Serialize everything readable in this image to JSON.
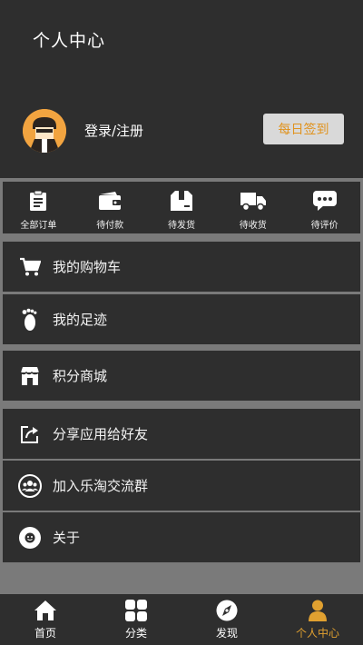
{
  "header": {
    "title": "个人中心",
    "login_text": "登录/注册",
    "checkin_label": "每日签到"
  },
  "orders": [
    {
      "label": "全部订单",
      "icon": "clipboard-icon"
    },
    {
      "label": "待付款",
      "icon": "wallet-icon"
    },
    {
      "label": "待发货",
      "icon": "package-icon"
    },
    {
      "label": "待收货",
      "icon": "truck-icon"
    },
    {
      "label": "待评价",
      "icon": "chat-bubble-icon"
    }
  ],
  "menu": [
    {
      "label": "我的购物车",
      "icon": "shopping-cart-icon"
    },
    {
      "label": "我的足迹",
      "icon": "footprint-icon"
    },
    {
      "label": "积分商城",
      "icon": "store-icon"
    },
    {
      "label": "分享应用给好友",
      "icon": "share-icon"
    },
    {
      "label": "加入乐淘交流群",
      "icon": "group-icon"
    },
    {
      "label": "关于",
      "icon": "info-icon"
    }
  ],
  "tabs": [
    {
      "label": "首页",
      "icon": "home-icon"
    },
    {
      "label": "分类",
      "icon": "grid-icon"
    },
    {
      "label": "发现",
      "icon": "compass-icon"
    },
    {
      "label": "个人中心",
      "icon": "person-icon",
      "active": true
    }
  ],
  "colors": {
    "accent": "#e0a030",
    "background": "#2e2e2e",
    "separator": "#7a7a7a"
  }
}
